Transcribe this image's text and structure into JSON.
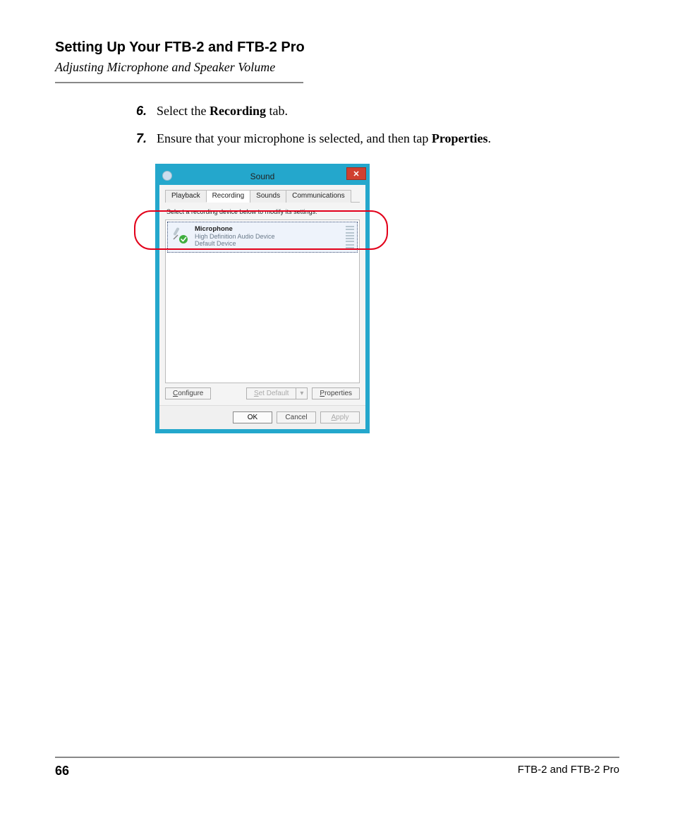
{
  "header": {
    "chapter": "Setting Up Your FTB-2 and FTB-2 Pro",
    "section": "Adjusting Microphone and Speaker Volume"
  },
  "steps": {
    "s6": {
      "num": "6.",
      "pre": "Select the ",
      "bold": "Recording",
      "post": " tab."
    },
    "s7": {
      "num": "7.",
      "pre": "Ensure that your microphone is selected, and then tap ",
      "bold": "Properties",
      "post": "."
    }
  },
  "dialog": {
    "title": "Sound",
    "close_glyph": "✕",
    "tabs": {
      "playback": "Playback",
      "recording": "Recording",
      "sounds": "Sounds",
      "communications": "Communications"
    },
    "instruction": "Select a recording device below to modify its settings:",
    "device": {
      "name": "Microphone",
      "sub": "High Definition Audio Device",
      "status": "Default Device"
    },
    "buttons": {
      "configure": "Configure",
      "set_default": "Set Default",
      "dropdown_glyph": "▾",
      "properties": "Properties",
      "ok": "OK",
      "cancel": "Cancel",
      "apply": "Apply"
    }
  },
  "footer": {
    "page": "66",
    "doc": "FTB-2 and FTB-2 Pro"
  }
}
